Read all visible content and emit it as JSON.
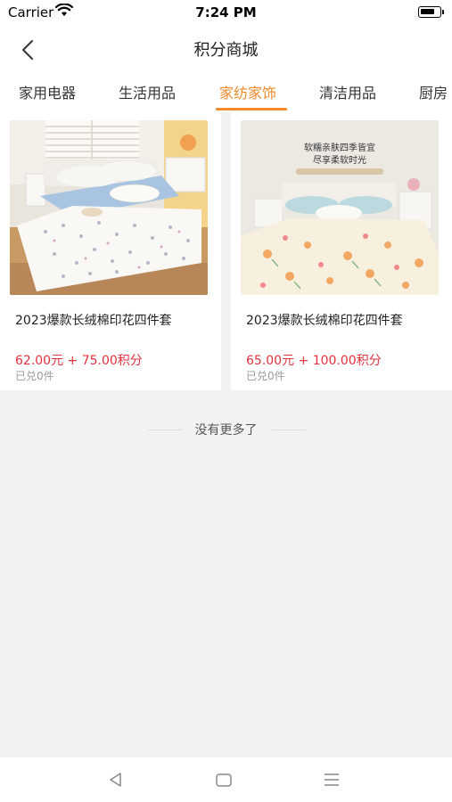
{
  "status": {
    "carrier": "Carrier",
    "time": "7:24 PM"
  },
  "header": {
    "title": "积分商城"
  },
  "tabs": [
    {
      "label": "家用电器",
      "active": false
    },
    {
      "label": "生活用品",
      "active": false
    },
    {
      "label": "家纺家饰",
      "active": true
    },
    {
      "label": "清洁用品",
      "active": false
    },
    {
      "label": "厨房",
      "active": false
    }
  ],
  "products": [
    {
      "name": "2023爆款长绒棉印花四件套",
      "price": "62.00元 + 75.00积分",
      "sold": "已兑0件",
      "image_caption": []
    },
    {
      "name": "2023爆款长绒棉印花四件套",
      "price": "65.00元 + 100.00积分",
      "sold": "已兑0件",
      "image_caption": [
        "软糯亲肤四季皆宜",
        "尽享柔软时光"
      ]
    }
  ],
  "footer": {
    "no_more": "没有更多了"
  },
  "colors": {
    "accent": "#f08a2b",
    "price": "#e2323d",
    "background": "#f2f2f3"
  }
}
